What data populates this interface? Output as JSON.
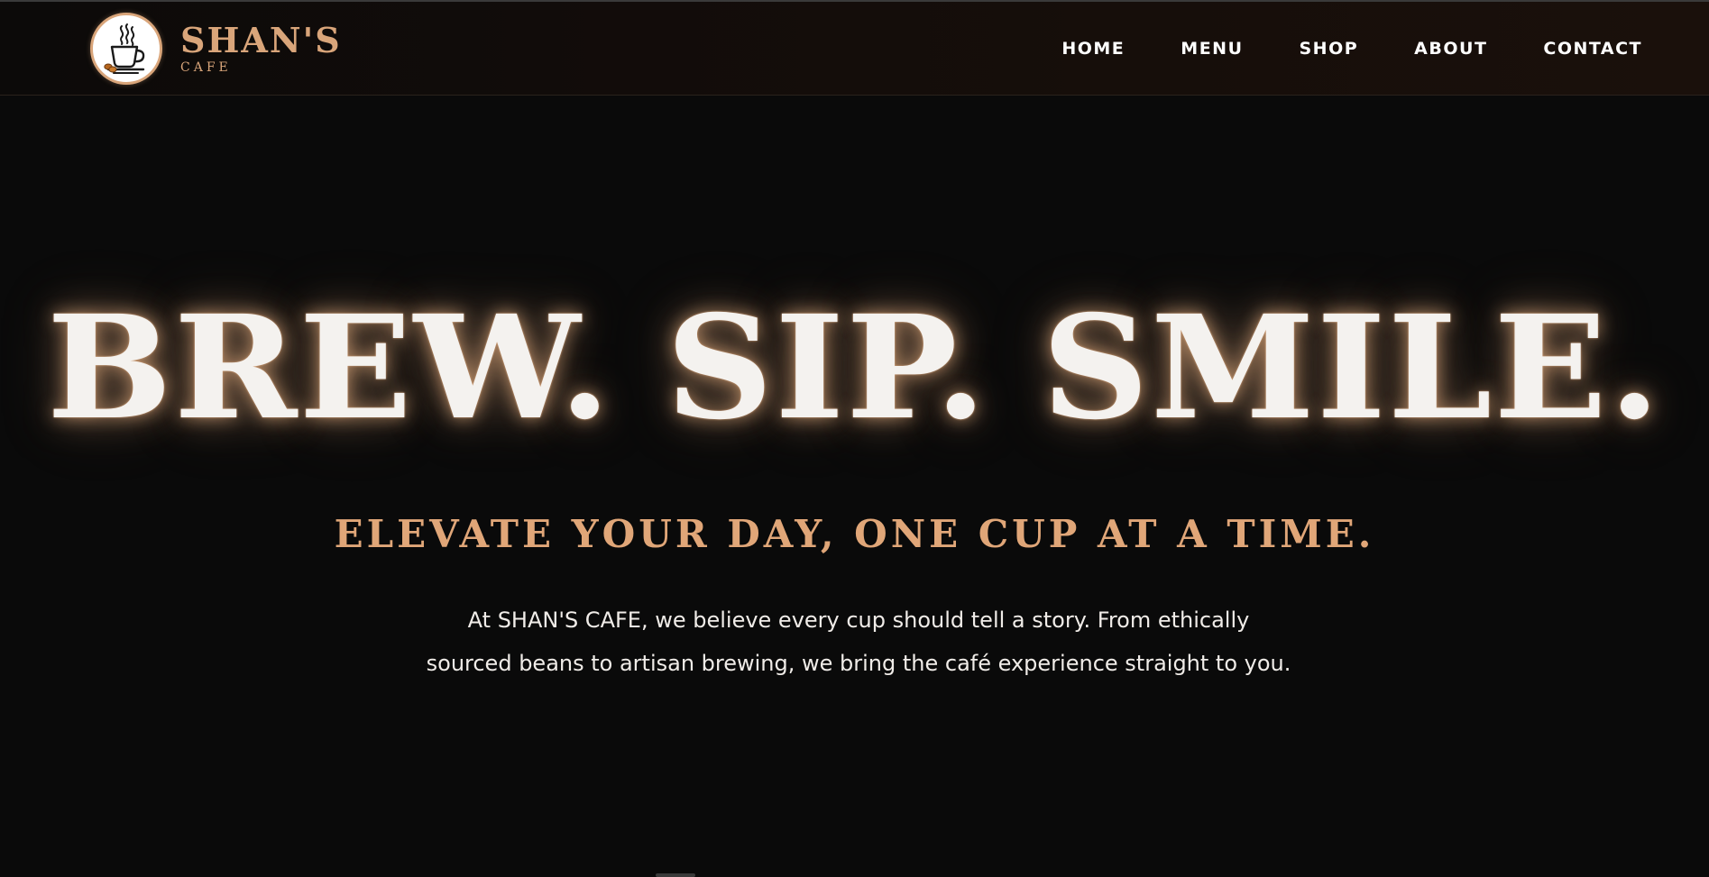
{
  "brand": {
    "name": "SHAN'S",
    "subtitle": "CAFE",
    "logo_icon": "coffee-cup-steam-icon",
    "accent_color": "#d9a57a"
  },
  "nav": {
    "items": [
      {
        "label": "HOME"
      },
      {
        "label": "MENU"
      },
      {
        "label": "SHOP"
      },
      {
        "label": "ABOUT"
      },
      {
        "label": "CONTACT"
      }
    ]
  },
  "hero": {
    "title": "BREW. SIP. SMILE.",
    "tagline": "ELEVATE YOUR DAY, ONE CUP AT A TIME.",
    "description": "At SHAN'S CAFE, we believe every cup should tell a story. From ethically sourced beans to artisan brewing, we bring the café experience straight to you."
  },
  "colors": {
    "background": "#0a0a0a",
    "title_glow": "#d9a57a",
    "tagline": "#e0a678",
    "nav_text": "#ffffff"
  }
}
